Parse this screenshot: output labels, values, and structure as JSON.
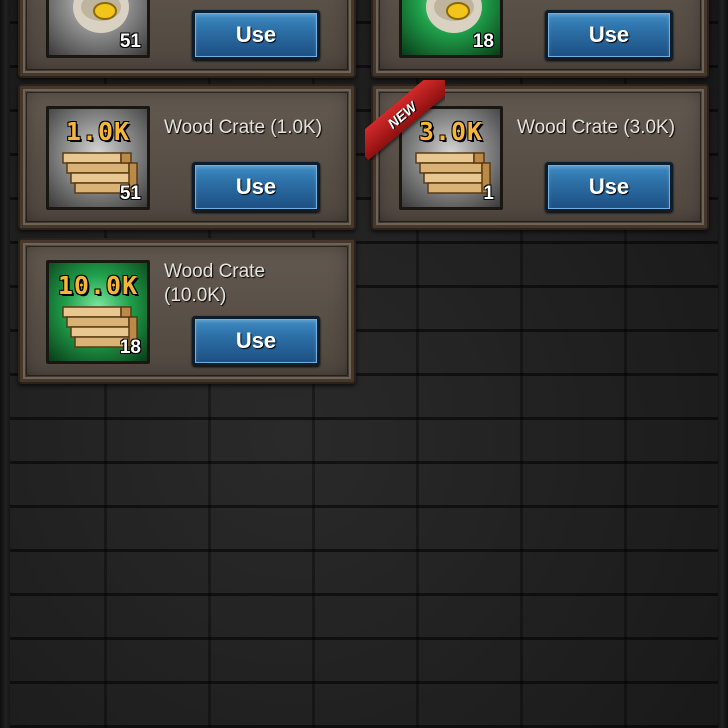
{
  "items": [
    {
      "name": "",
      "quantity": "51",
      "button": "Use",
      "style": "grey",
      "icon": "gold-sack-icon"
    },
    {
      "name": "",
      "quantity": "18",
      "button": "Use",
      "style": "green",
      "icon": "gold-sack-icon"
    },
    {
      "name": "Wood Crate (1.0K)",
      "amount": "1.0K",
      "quantity": "51",
      "button": "Use",
      "style": "grey",
      "icon": "wood-crate-icon"
    },
    {
      "name": "Wood Crate (3.0K)",
      "amount": "3.0K",
      "quantity": "1",
      "button": "Use",
      "style": "grey",
      "icon": "wood-crate-icon",
      "badge": "NEW"
    },
    {
      "name_line1": "Wood Crate",
      "name_line2": "(10.0K)",
      "amount": "10.0K",
      "quantity": "18",
      "button": "Use",
      "style": "green",
      "icon": "wood-crate-icon"
    }
  ],
  "colors": {
    "button": "#2c6fa6",
    "amount": "#f6b63c",
    "ribbon": "#c21f1f",
    "card": "#5d534a"
  }
}
